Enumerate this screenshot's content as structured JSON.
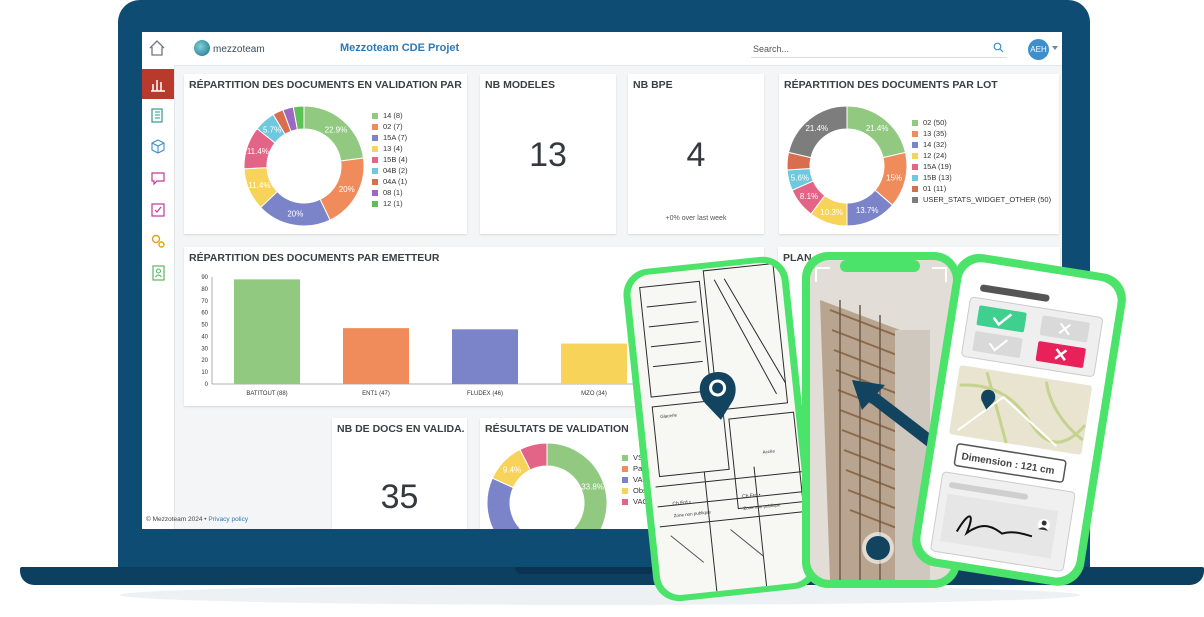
{
  "header": {
    "logo_text": "mezzoteam",
    "project_title": "Mezzoteam CDE Projet",
    "search_placeholder": "Search...",
    "avatar_initials": "AEH"
  },
  "sidebar": {
    "items": [
      {
        "name": "dashboard",
        "icon": "bar-chart-icon",
        "active": true
      },
      {
        "name": "documents",
        "icon": "documents-icon",
        "active": false
      },
      {
        "name": "models",
        "icon": "cubes-icon",
        "active": false
      },
      {
        "name": "messages",
        "icon": "chat-icon",
        "active": false
      },
      {
        "name": "tasks",
        "icon": "checklist-icon",
        "active": false
      },
      {
        "name": "workflows",
        "icon": "gears-icon",
        "active": false
      },
      {
        "name": "contacts",
        "icon": "address-book-icon",
        "active": false
      }
    ]
  },
  "cards": {
    "validation_title": "RÉPARTITION DES DOCUMENTS EN VALIDATION PAR L...",
    "models_title": "NB MODELES",
    "models_value": "13",
    "bpe_title": "NB BPE",
    "bpe_value": "4",
    "bpe_sub": "+0% over last week",
    "lot_title": "RÉPARTITION DES DOCUMENTS PAR LOT",
    "emetteur_title": "RÉPARTITION DES DOCUMENTS PAR EMETTEUR",
    "plan_title": "PLAN",
    "nbdocs_title": "NB DE DOCS EN VALIDA...",
    "nbdocs_value": "35",
    "results_title": "RÉSULTATS DE VALIDATION"
  },
  "footer": {
    "copyright": "© Mezzoteam 2024 • ",
    "privacy_link": "Privacy policy"
  },
  "mockups": {
    "dimension_label": "Dimension :  121 cm",
    "plan_labels": [
      "Ch.Frd •",
      "Ch.Frd •",
      "Zone non publique",
      "Zone non publique",
      "Glacerie",
      "Accès"
    ]
  },
  "colors": {
    "brand_blue": "#0f4c74",
    "accent_green": "#4be36a",
    "active_red": "#b83a2c",
    "link_blue": "#2a7ab8"
  },
  "chart_data": [
    {
      "type": "pie",
      "title": "RÉPARTITION DES DOCUMENTS EN VALIDATION PAR L...",
      "legend_position": "right",
      "categories": [
        "14 (8)",
        "02 (7)",
        "15A (7)",
        "13 (4)",
        "15B (4)",
        "04B (2)",
        "04A (1)",
        "08 (1)",
        "12 (1)"
      ],
      "values": [
        8,
        7,
        7,
        4,
        4,
        2,
        1,
        1,
        1
      ],
      "data_labels": [
        "22.9%",
        "20%",
        "20%",
        "11.4%",
        "11.4%",
        "5.7%",
        "",
        "",
        ""
      ],
      "colors": [
        "#91c981",
        "#f08c5c",
        "#7b84c9",
        "#f7d35a",
        "#e36486",
        "#6fc9de",
        "#d86e4d",
        "#9c68c2",
        "#5ec157"
      ]
    },
    {
      "type": "pie",
      "title": "RÉPARTITION DES DOCUMENTS PAR LOT",
      "legend_position": "right",
      "categories": [
        "02 (50)",
        "13 (35)",
        "14 (32)",
        "12 (24)",
        "15A (19)",
        "15B (13)",
        "01 (11)",
        "USER_STATS_WIDGET_OTHER (50)"
      ],
      "values": [
        50,
        35,
        32,
        24,
        19,
        13,
        11,
        50
      ],
      "data_labels": [
        "21.4%",
        "15%",
        "13.7%",
        "10.3%",
        "8.1%",
        "5.6%",
        "",
        "21.4%"
      ],
      "colors": [
        "#91c981",
        "#f08c5c",
        "#7b84c9",
        "#f7d35a",
        "#e36486",
        "#6fc9de",
        "#d86e4d",
        "#7d7d7d"
      ]
    },
    {
      "type": "bar",
      "title": "RÉPARTITION DES DOCUMENTS PAR EMETTEUR",
      "categories": [
        "BATITOUT (88)",
        "ENT1 (47)",
        "FLUDEX (46)",
        "MZO (34)"
      ],
      "values": [
        88,
        47,
        46,
        34
      ],
      "colors": [
        "#91c981",
        "#f08c5c",
        "#7b84c9",
        "#f7d35a"
      ],
      "ylim": [
        0,
        90
      ],
      "yticks": [
        "0",
        "10",
        "20",
        "30",
        "40",
        "50",
        "60",
        "70",
        "80",
        "90"
      ]
    },
    {
      "type": "pie",
      "title": "RÉSULTATS DE VALIDATION",
      "legend_position": "right",
      "categories": [
        "VSO (47)",
        "Pas d'observ...",
        "VAO (23)",
        "Observations...",
        "VAOS (1)"
      ],
      "values": [
        47,
        29,
        23,
        13,
        9
      ],
      "data_labels": [
        "33.8%",
        "",
        "",
        "9.4%",
        ""
      ],
      "colors": [
        "#91c981",
        "#f08c5c",
        "#7b84c9",
        "#f7d35a",
        "#e36486",
        "#6fc9de",
        "#9c68c2"
      ]
    }
  ]
}
